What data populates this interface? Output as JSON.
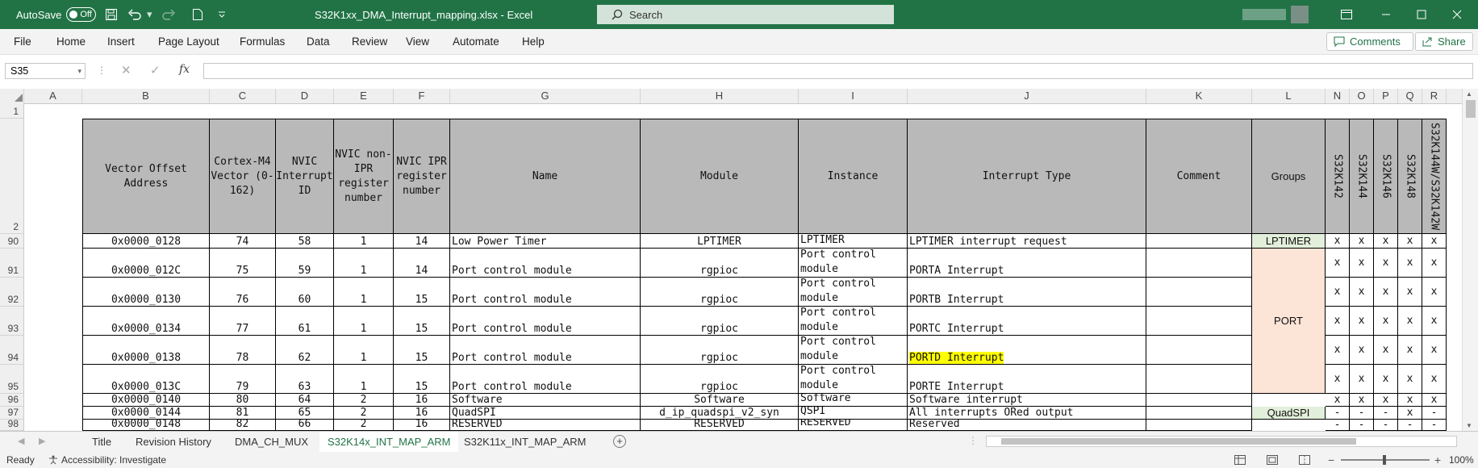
{
  "titlebar": {
    "autosave_label": "AutoSave",
    "autosave_state": "Off",
    "file_title": "S32K1xx_DMA_Interrupt_mapping.xlsx  -  Excel",
    "search_placeholder": "Search",
    "accent_color": "#217346"
  },
  "ribbon": {
    "tabs": [
      "File",
      "Home",
      "Insert",
      "Page Layout",
      "Formulas",
      "Data",
      "Review",
      "View",
      "Automate",
      "Help"
    ],
    "comments_label": "Comments",
    "share_label": "Share"
  },
  "formula_bar": {
    "name_box": "S35",
    "fx_label": "fx",
    "formula": ""
  },
  "columns": [
    "A",
    "B",
    "C",
    "D",
    "E",
    "F",
    "G",
    "H",
    "I",
    "J",
    "K",
    "L",
    "N",
    "O",
    "P",
    "Q",
    "R"
  ],
  "header_row": {
    "row_number": "2",
    "vector_offset": "Vector Offset Address",
    "cortex_vector": "Cortex-M4 Vector (0-162)",
    "nvic_irq": "NVIC Interrupt ID",
    "nvic_non_ipr": "NVIC non-IPR register number",
    "nvic_ipr": "NVIC IPR register number",
    "name": "Name",
    "module": "Module",
    "instance": "Instance",
    "interrupt_type": "Interrupt Type",
    "comment": "Comment",
    "groups": "Groups",
    "dev1": "S32K142",
    "dev2": "S32K144",
    "dev3": "S32K146",
    "dev4": "S32K148",
    "dev5": "S32K144W/S32K142W"
  },
  "row1_number": "1",
  "rows": [
    {
      "row": "90",
      "offset": "0x0000_0128",
      "vector": "74",
      "irq": "58",
      "nonipr": "1",
      "ipr": "14",
      "name": "Low Power Timer",
      "module": "LPTIMER",
      "instance": "LPTIMER",
      "itype": "LPTIMER interrupt request",
      "x1": "x",
      "x2": "x",
      "x3": "x",
      "x4": "x",
      "x5": "x"
    },
    {
      "row": "91",
      "offset": "0x0000_012C",
      "vector": "75",
      "irq": "59",
      "nonipr": "1",
      "ipr": "14",
      "name": "Port control module",
      "module": "rgpioc",
      "instance": "Port control module",
      "itype": "PORTA Interrupt",
      "x1": "x",
      "x2": "x",
      "x3": "x",
      "x4": "x",
      "x5": "x"
    },
    {
      "row": "92",
      "offset": "0x0000_0130",
      "vector": "76",
      "irq": "60",
      "nonipr": "1",
      "ipr": "15",
      "name": "Port control module",
      "module": "rgpioc",
      "instance": "Port control module",
      "itype": "PORTB Interrupt",
      "x1": "x",
      "x2": "x",
      "x3": "x",
      "x4": "x",
      "x5": "x"
    },
    {
      "row": "93",
      "offset": "0x0000_0134",
      "vector": "77",
      "irq": "61",
      "nonipr": "1",
      "ipr": "15",
      "name": "Port control module",
      "module": "rgpioc",
      "instance": "Port control module",
      "itype": "PORTC Interrupt",
      "x1": "x",
      "x2": "x",
      "x3": "x",
      "x4": "x",
      "x5": "x"
    },
    {
      "row": "94",
      "offset": "0x0000_0138",
      "vector": "78",
      "irq": "62",
      "nonipr": "1",
      "ipr": "15",
      "name": "Port control module",
      "module": "rgpioc",
      "instance": "Port control module",
      "itype": "PORTD Interrupt",
      "x1": "x",
      "x2": "x",
      "x3": "x",
      "x4": "x",
      "x5": "x"
    },
    {
      "row": "95",
      "offset": "0x0000_013C",
      "vector": "79",
      "irq": "63",
      "nonipr": "1",
      "ipr": "15",
      "name": "Port control module",
      "module": "rgpioc",
      "instance": "Port control module",
      "itype": "PORTE Interrupt",
      "x1": "x",
      "x2": "x",
      "x3": "x",
      "x4": "x",
      "x5": "x"
    },
    {
      "row": "96",
      "offset": "0x0000_0140",
      "vector": "80",
      "irq": "64",
      "nonipr": "2",
      "ipr": "16",
      "name": "Software",
      "module": "Software",
      "instance": "Software",
      "itype": "Software interrupt",
      "x1": "x",
      "x2": "x",
      "x3": "x",
      "x4": "x",
      "x5": "x"
    },
    {
      "row": "97",
      "offset": "0x0000_0144",
      "vector": "81",
      "irq": "65",
      "nonipr": "2",
      "ipr": "16",
      "name": "QuadSPI",
      "module": "d_ip_quadspi_v2_syn",
      "instance": "QSPI",
      "itype": "All interrupts ORed output",
      "x1": "-",
      "x2": "-",
      "x3": "-",
      "x4": "x",
      "x5": "-"
    },
    {
      "row": "98",
      "offset": "0x0000_0148",
      "vector": "82",
      "irq": "66",
      "nonipr": "2",
      "ipr": "16",
      "name": "RESERVED",
      "module": "RESERVED",
      "instance": "RESERVED",
      "itype": "Reserved",
      "x1": "-",
      "x2": "-",
      "x3": "-",
      "x4": "-",
      "x5": "-"
    }
  ],
  "groups": {
    "lptimer": "LPTIMER",
    "port": "PORT",
    "quadspi": "QuadSPI"
  },
  "colors": {
    "header_fill": "#b9b9b9",
    "lptimer_fill": "#e2efda",
    "port_fill": "#fce4d6",
    "highlight": "#ffff00"
  },
  "sheet_tabs": [
    "Title",
    "Revision History",
    "DMA_CH_MUX",
    "S32K14x_INT_MAP_ARM",
    "S32K11x_INT_MAP_ARM"
  ],
  "active_sheet": "S32K14x_INT_MAP_ARM",
  "statusbar": {
    "ready": "Ready",
    "accessibility": "Accessibility: Investigate",
    "zoom": "100%"
  }
}
